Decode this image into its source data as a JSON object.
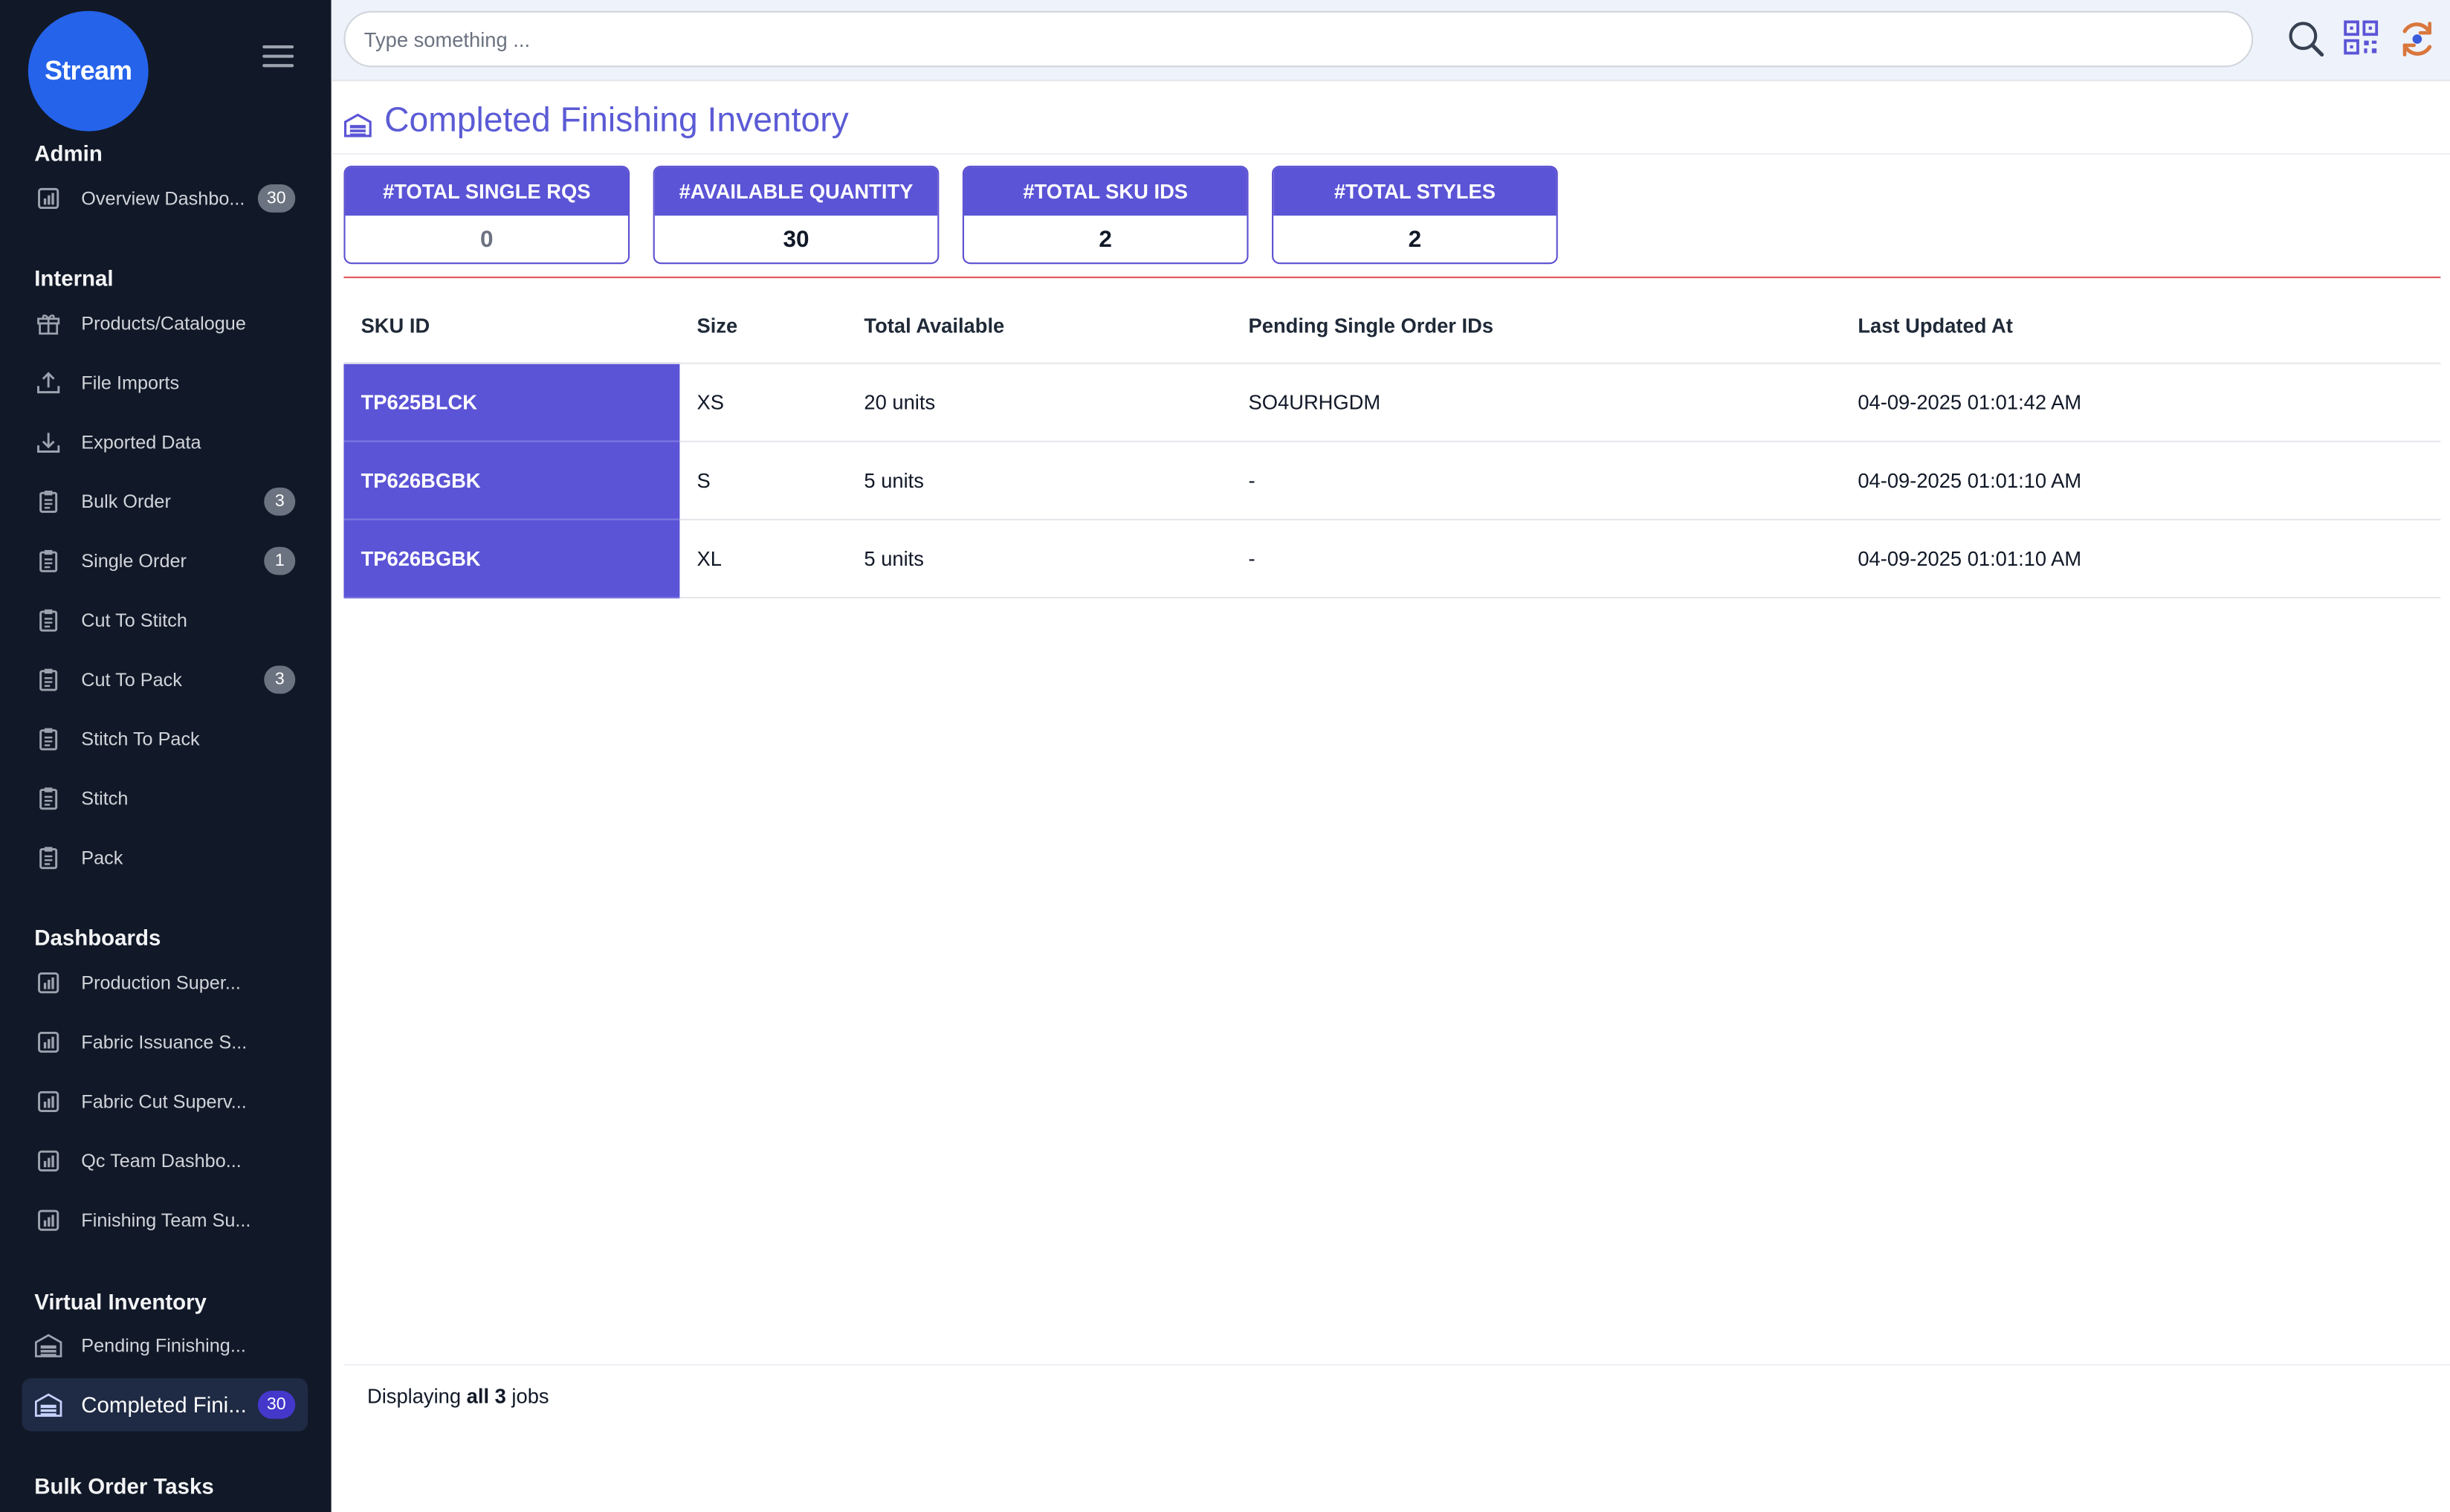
{
  "app": {
    "logo_text": "Stream"
  },
  "search": {
    "placeholder": "Type something ..."
  },
  "sidebar": {
    "sections": [
      {
        "title": "Admin",
        "items": [
          {
            "label": "Overview Dashbo...",
            "icon": "chart-icon",
            "badge": "30"
          }
        ]
      },
      {
        "title": "Internal",
        "items": [
          {
            "label": "Products/Catalogue",
            "icon": "gift-icon",
            "badge": ""
          },
          {
            "label": "File Imports",
            "icon": "upload-icon",
            "badge": ""
          },
          {
            "label": "Exported Data",
            "icon": "download-icon",
            "badge": ""
          },
          {
            "label": "Bulk Order",
            "icon": "clipboard-icon",
            "badge": "3"
          },
          {
            "label": "Single Order",
            "icon": "clipboard-icon",
            "badge": "1"
          },
          {
            "label": "Cut To Stitch",
            "icon": "clipboard-icon",
            "badge": ""
          },
          {
            "label": "Cut To Pack",
            "icon": "clipboard-icon",
            "badge": "3"
          },
          {
            "label": "Stitch To Pack",
            "icon": "clipboard-icon",
            "badge": ""
          },
          {
            "label": "Stitch",
            "icon": "clipboard-icon",
            "badge": ""
          },
          {
            "label": "Pack",
            "icon": "clipboard-icon",
            "badge": ""
          }
        ]
      },
      {
        "title": "Dashboards",
        "items": [
          {
            "label": "Production Super...",
            "icon": "chart-icon",
            "badge": ""
          },
          {
            "label": "Fabric Issuance S...",
            "icon": "chart-icon",
            "badge": ""
          },
          {
            "label": "Fabric Cut Superv...",
            "icon": "chart-icon",
            "badge": ""
          },
          {
            "label": "Qc Team Dashbo...",
            "icon": "chart-icon",
            "badge": ""
          },
          {
            "label": "Finishing Team Su...",
            "icon": "chart-icon",
            "badge": ""
          }
        ]
      },
      {
        "title": "Virtual Inventory",
        "items": [
          {
            "label": "Pending Finishing...",
            "icon": "warehouse-icon",
            "badge": ""
          },
          {
            "label": "Completed Fini...",
            "icon": "warehouse-icon",
            "badge": "30",
            "active": true
          }
        ]
      },
      {
        "title": "Bulk Order Tasks",
        "items": []
      }
    ]
  },
  "page": {
    "title": "Completed Finishing Inventory"
  },
  "stats": [
    {
      "label": "#TOTAL SINGLE RQS",
      "value": "0"
    },
    {
      "label": "#AVAILABLE QUANTITY",
      "value": "30"
    },
    {
      "label": "#TOTAL SKU IDS",
      "value": "2"
    },
    {
      "label": "#TOTAL STYLES",
      "value": "2"
    }
  ],
  "table": {
    "columns": [
      "SKU ID",
      "Size",
      "Total Available",
      "Pending Single Order IDs",
      "Last Updated At"
    ],
    "rows": [
      [
        "TP625BLCK",
        "XS",
        "20 units",
        "SO4URHGDM",
        "04-09-2025 01:01:42 AM"
      ],
      [
        "TP626BGBK",
        "S",
        "5 units",
        "-",
        "04-09-2025 01:01:10 AM"
      ],
      [
        "TP626BGBK",
        "XL",
        "5 units",
        "-",
        "04-09-2025 01:01:10 AM"
      ]
    ]
  },
  "footer": {
    "prefix": "Displaying ",
    "bold": "all 3",
    "suffix": " jobs"
  },
  "colors": {
    "accent": "#5b54d6",
    "sidebar_bg": "#111827",
    "logo_bg": "#2563eb",
    "divider_red": "#e25555"
  }
}
